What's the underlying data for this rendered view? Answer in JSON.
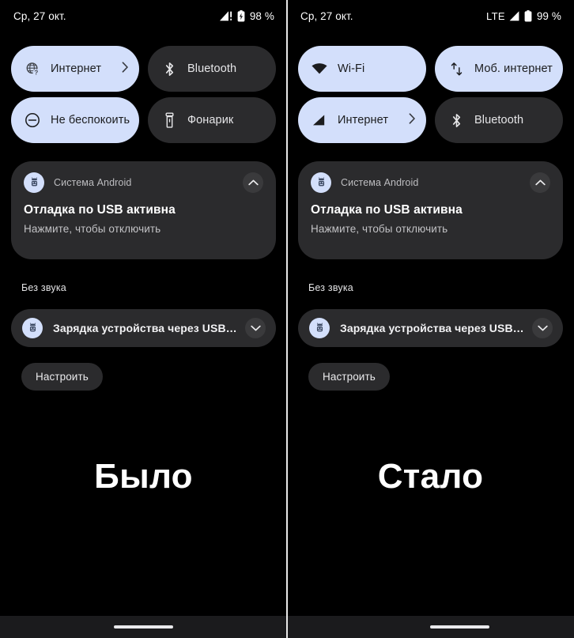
{
  "panels": [
    {
      "id": "before",
      "caption": "Было",
      "status": {
        "date": "Ср, 27 окт.",
        "network_label": "",
        "battery_percent": "98 %",
        "signal_icon": "signal-warning-icon",
        "battery_icon": "battery-charging-icon"
      },
      "tiles": [
        {
          "label": "Интернет",
          "icon": "globe-question-icon",
          "state": "on",
          "has_chevron": true
        },
        {
          "label": "Bluetooth",
          "icon": "bluetooth-icon",
          "state": "off",
          "has_chevron": false
        },
        {
          "label": "Не беспокоить",
          "icon": "do-not-disturb-icon",
          "state": "on",
          "has_chevron": false
        },
        {
          "label": "Фонарик",
          "icon": "flashlight-icon",
          "state": "off",
          "has_chevron": false
        }
      ],
      "notification": {
        "app_name": "Система Android",
        "app_icon": "usb-android-icon",
        "title": "Отладка по USB активна",
        "subtitle": "Нажмите, чтобы отключить",
        "expand_icon": "chevron-up-icon"
      },
      "silent_section_label": "Без звука",
      "charge_row": {
        "text": "Зарядка устройства через USB…",
        "icon": "usb-android-icon",
        "expand_icon": "chevron-down-icon"
      },
      "configure_button": "Настроить"
    },
    {
      "id": "after",
      "caption": "Стало",
      "status": {
        "date": "Ср, 27 окт.",
        "network_label": "LTE",
        "battery_percent": "99 %",
        "signal_icon": "signal-bars-icon",
        "battery_icon": "battery-full-icon"
      },
      "tiles": [
        {
          "label": "Wi-Fi",
          "icon": "wifi-icon",
          "state": "on",
          "has_chevron": false
        },
        {
          "label": "Моб. интернет",
          "icon": "mobile-data-icon",
          "state": "on",
          "has_chevron": false
        },
        {
          "label": "Интернет",
          "icon": "signal-bars-icon",
          "state": "on",
          "has_chevron": true
        },
        {
          "label": "Bluetooth",
          "icon": "bluetooth-icon",
          "state": "off",
          "has_chevron": false
        }
      ],
      "notification": {
        "app_name": "Система Android",
        "app_icon": "usb-android-icon",
        "title": "Отладка по USB активна",
        "subtitle": "Нажмите, чтобы отключить",
        "expand_icon": "chevron-up-icon"
      },
      "silent_section_label": "Без звука",
      "charge_row": {
        "text": "Зарядка устройства через USB…",
        "icon": "usb-android-icon",
        "expand_icon": "chevron-down-icon"
      },
      "configure_button": "Настроить"
    }
  ],
  "colors": {
    "background": "#000000",
    "tile_on": "#d3dffb",
    "tile_off": "#2b2b2d",
    "card": "#2b2b2d",
    "text_primary": "#ffffff",
    "text_secondary": "#bdbdc0",
    "divider": "#e8e8e8"
  }
}
